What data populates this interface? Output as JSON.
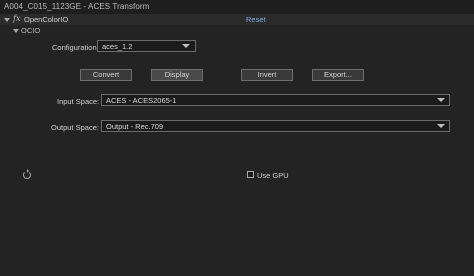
{
  "window": {
    "title": "A004_C015_1123GE - ACES Transform"
  },
  "effect": {
    "name": "OpenColorIO",
    "fx_icon": "fx",
    "reset_label": "Reset",
    "group_label": "OCIO"
  },
  "configuration": {
    "label": "Configuration:",
    "value": "aces_1.2"
  },
  "buttons": {
    "convert": "Convert",
    "display": "Display",
    "invert": "Invert",
    "export": "Export..."
  },
  "input_space": {
    "label": "Input Space:",
    "value": "ACES - ACES2065-1"
  },
  "output_space": {
    "label": "Output Space:",
    "value": "Output - Rec.709"
  },
  "gpu": {
    "label": "Use GPU",
    "checked": false
  },
  "colors": {
    "background": "#232323",
    "accent_link": "#7cb2e8"
  }
}
